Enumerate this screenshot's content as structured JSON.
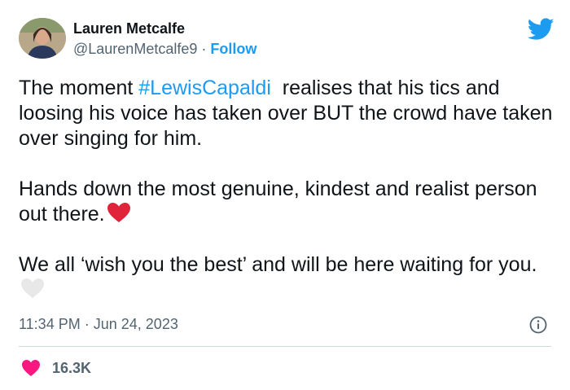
{
  "author": {
    "display_name": "Lauren Metcalfe",
    "handle": "@LaurenMetcalfe9",
    "separator": "·",
    "follow_label": "Follow"
  },
  "tweet": {
    "para1_hashtag_prefix": "The moment ",
    "hashtag": "#LewisCapaldi",
    "para1_rest": "  realises that his tics and loosing his voice has taken over BUT the crowd have taken over singing for him.",
    "para2": "Hands down the most genuine, kindest and realist person out there.",
    "para3": "We all ‘wish you the best’ and will be here waiting for you."
  },
  "meta": {
    "time": "11:34 PM",
    "separator": "·",
    "date": "Jun 24, 2023"
  },
  "engagement": {
    "likes": "16.3K"
  },
  "icons": {
    "brand": "twitter-bird-icon",
    "info": "info-icon",
    "like": "heart-icon"
  },
  "colors": {
    "accent": "#1d9bf0",
    "text": "#0f1419",
    "muted": "#536471",
    "like": "#f91880",
    "red_heart": "#e0243a",
    "white_heart": "#e8e8e8"
  }
}
